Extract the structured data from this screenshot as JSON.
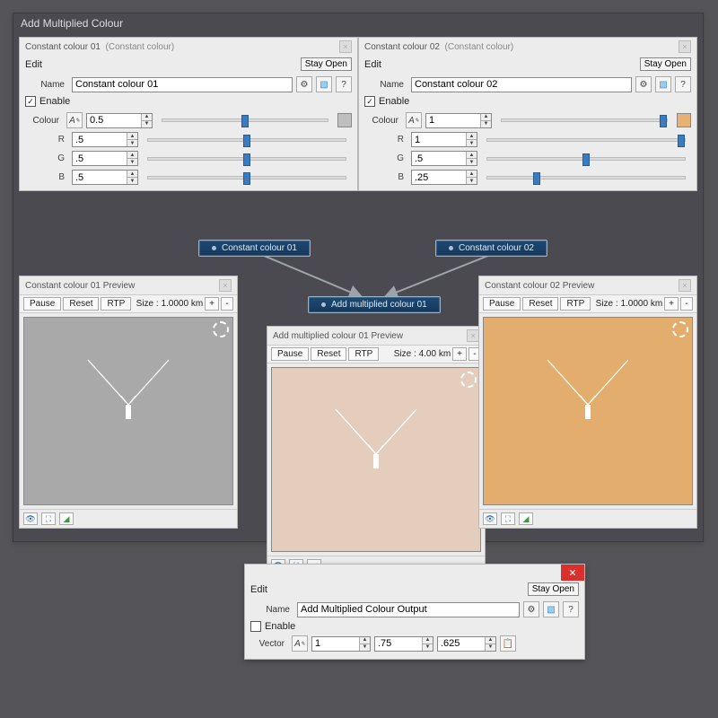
{
  "outer_title": "Add Multiplied Colour",
  "labels": {
    "edit": "Edit",
    "stay_open": "Stay Open",
    "name": "Name",
    "enable": "Enable",
    "colour": "Colour",
    "r": "R",
    "g": "G",
    "b": "B",
    "pause": "Pause",
    "reset": "Reset",
    "rtp": "RTP",
    "size_prefix": "Size :",
    "plus": "+",
    "minus": "-",
    "help": "?",
    "vector": "Vector"
  },
  "editor1": {
    "title": "Constant colour 01",
    "subtitle": "(Constant colour)",
    "name_value": "Constant colour 01",
    "enable_checked": true,
    "colour_value": "0.5",
    "r": ".5",
    "g": ".5",
    "b": ".5",
    "swatch": "#bfbfbf",
    "slider_main": 50,
    "slider_r": 50,
    "slider_g": 50,
    "slider_b": 50
  },
  "editor2": {
    "title": "Constant colour 02",
    "subtitle": "(Constant colour)",
    "name_value": "Constant colour 02",
    "enable_checked": true,
    "colour_value": "1",
    "r": "1",
    "g": ".5",
    "b": ".25",
    "swatch": "#e6b172",
    "slider_main": 100,
    "slider_r": 100,
    "slider_g": 50,
    "slider_b": 25
  },
  "nodes": {
    "chip1": "Constant colour 01",
    "chip2": "Constant colour 02",
    "chip_result": "Add multiplied colour 01"
  },
  "preview1": {
    "title": "Constant colour 01 Preview",
    "size": "1.0000 km",
    "bg": "#a9a9a9"
  },
  "preview2": {
    "title": "Constant colour 02 Preview",
    "size": "1.0000 km",
    "bg": "#e3ad6e"
  },
  "preview_result": {
    "title": "Add multiplied colour 01 Preview",
    "size": "4.00 km",
    "bg": "#e4cdbd"
  },
  "output": {
    "name_value": "Add Multiplied Colour Output",
    "enable_checked": false,
    "vec_x": "1",
    "vec_y": ".75",
    "vec_z": ".625"
  }
}
